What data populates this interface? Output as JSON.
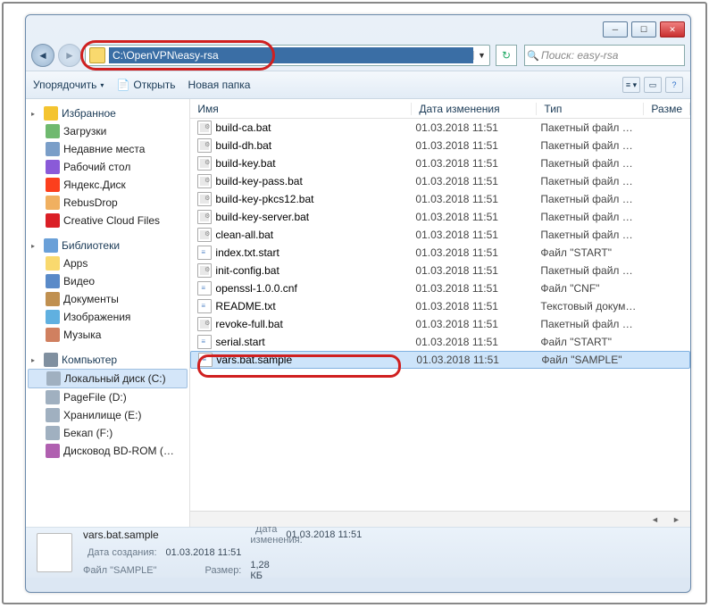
{
  "address": {
    "path": "C:\\OpenVPN\\easy-rsa"
  },
  "search": {
    "placeholder": "Поиск: easy-rsa"
  },
  "toolbar": {
    "organize": "Упорядочить",
    "open": "Открыть",
    "newfolder": "Новая папка"
  },
  "columns": {
    "name": "Имя",
    "date": "Дата изменения",
    "type": "Тип",
    "size": "Разме"
  },
  "sidebar": {
    "favorites": {
      "label": "Избранное",
      "items": [
        {
          "label": "Загрузки",
          "cls": "dl"
        },
        {
          "label": "Недавние места",
          "cls": "recent"
        },
        {
          "label": "Рабочий стол",
          "cls": "desk"
        },
        {
          "label": "Яндекс.Диск",
          "cls": "ydisk"
        },
        {
          "label": "RebusDrop",
          "cls": "rebus"
        },
        {
          "label": "Creative Cloud Files",
          "cls": "cc"
        }
      ]
    },
    "libraries": {
      "label": "Библиотеки",
      "items": [
        {
          "label": "Apps",
          "cls": "apps"
        },
        {
          "label": "Видео",
          "cls": "vid"
        },
        {
          "label": "Документы",
          "cls": "doc"
        },
        {
          "label": "Изображения",
          "cls": "img"
        },
        {
          "label": "Музыка",
          "cls": "mus"
        }
      ]
    },
    "computer": {
      "label": "Компьютер",
      "items": [
        {
          "label": "Локальный диск (C:)",
          "cls": "hdd",
          "sel": true
        },
        {
          "label": "PageFile (D:)",
          "cls": "hdd"
        },
        {
          "label": "Хранилище (E:)",
          "cls": "hdd"
        },
        {
          "label": "Бекап (F:)",
          "cls": "hdd"
        },
        {
          "label": "Дисковод BD-ROM (…",
          "cls": "bd"
        }
      ]
    }
  },
  "files": [
    {
      "name": "build-ca.bat",
      "date": "01.03.2018 11:51",
      "type": "Пакетный файл …",
      "icon": "bat"
    },
    {
      "name": "build-dh.bat",
      "date": "01.03.2018 11:51",
      "type": "Пакетный файл …",
      "icon": "bat"
    },
    {
      "name": "build-key.bat",
      "date": "01.03.2018 11:51",
      "type": "Пакетный файл …",
      "icon": "bat"
    },
    {
      "name": "build-key-pass.bat",
      "date": "01.03.2018 11:51",
      "type": "Пакетный файл …",
      "icon": "bat"
    },
    {
      "name": "build-key-pkcs12.bat",
      "date": "01.03.2018 11:51",
      "type": "Пакетный файл …",
      "icon": "bat"
    },
    {
      "name": "build-key-server.bat",
      "date": "01.03.2018 11:51",
      "type": "Пакетный файл …",
      "icon": "bat"
    },
    {
      "name": "clean-all.bat",
      "date": "01.03.2018 11:51",
      "type": "Пакетный файл …",
      "icon": "bat"
    },
    {
      "name": "index.txt.start",
      "date": "01.03.2018 11:51",
      "type": "Файл \"START\"",
      "icon": "txt"
    },
    {
      "name": "init-config.bat",
      "date": "01.03.2018 11:51",
      "type": "Пакетный файл …",
      "icon": "bat"
    },
    {
      "name": "openssl-1.0.0.cnf",
      "date": "01.03.2018 11:51",
      "type": "Файл \"CNF\"",
      "icon": "txt"
    },
    {
      "name": "README.txt",
      "date": "01.03.2018 11:51",
      "type": "Текстовый докум…",
      "icon": "txt"
    },
    {
      "name": "revoke-full.bat",
      "date": "01.03.2018 11:51",
      "type": "Пакетный файл …",
      "icon": "bat"
    },
    {
      "name": "serial.start",
      "date": "01.03.2018 11:51",
      "type": "Файл \"START\"",
      "icon": "txt"
    },
    {
      "name": "vars.bat.sample",
      "date": "01.03.2018 11:51",
      "type": "Файл \"SAMPLE\"",
      "icon": "txt",
      "sel": true
    }
  ],
  "details": {
    "filename": "vars.bat.sample",
    "type_label": "Файл \"SAMPLE\"",
    "modified_label": "Дата изменения:",
    "modified": "01.03.2018 11:51",
    "size_label": "Размер:",
    "size": "1,28 КБ",
    "created_label": "Дата создания:",
    "created": "01.03.2018 11:51"
  }
}
